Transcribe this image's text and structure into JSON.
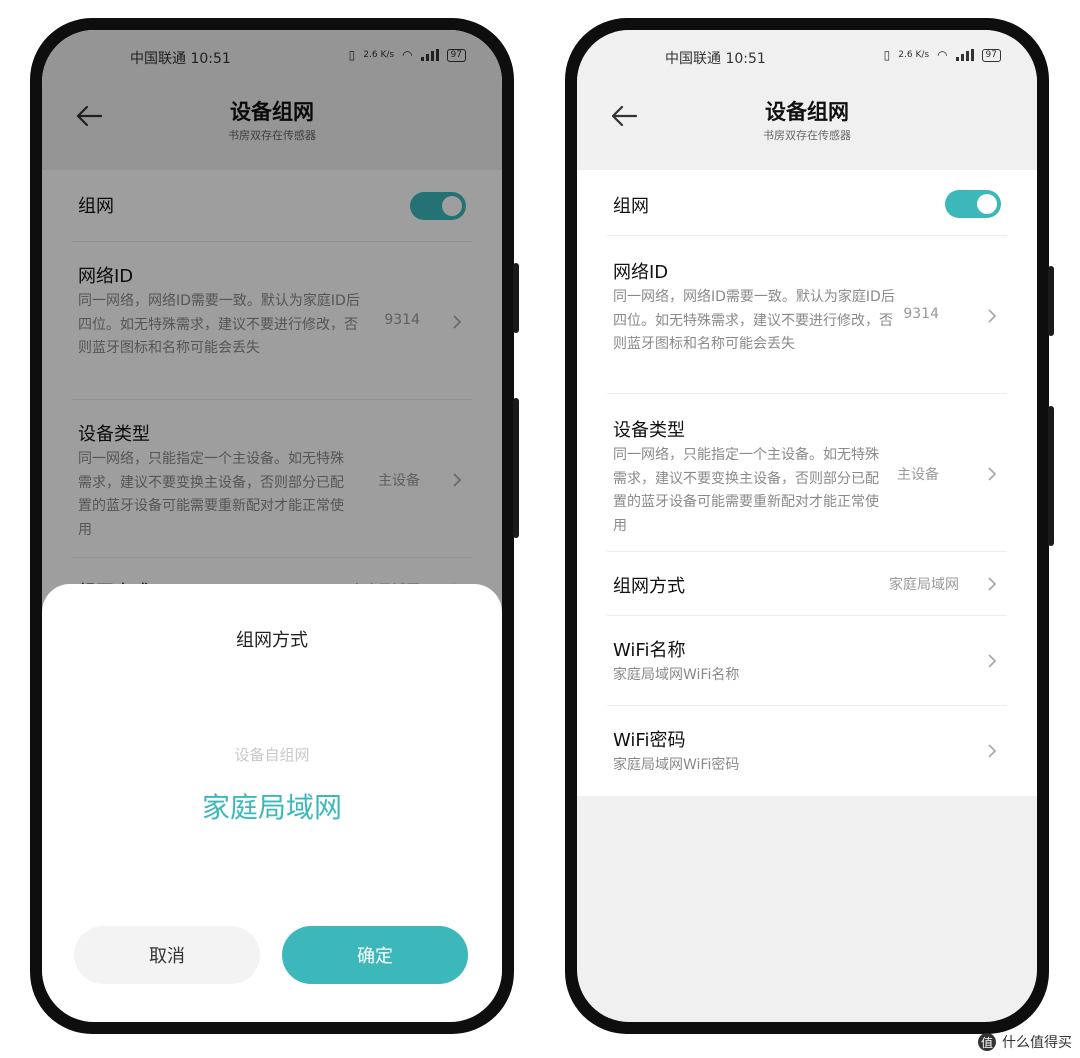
{
  "status_bar": {
    "carrier_time": "中国联通 10:51",
    "network_speed": "2.6 K/s",
    "battery": "97"
  },
  "header": {
    "title": "设备组网",
    "subtitle": "书房双存在传感器"
  },
  "settings": {
    "networking": {
      "label": "组网",
      "enabled": true
    },
    "network_id": {
      "title": "网络ID",
      "desc": "同一网络，网络ID需要一致。默认为家庭ID后四位。如无特殊需求，建议不要进行修改，否则蓝牙图标和名称可能会丢失",
      "value": "9314"
    },
    "device_type": {
      "title": "设备类型",
      "desc": "同一网络，只能指定一个主设备。如无特殊需求，建议不要变换主设备，否则部分已配置的蓝牙设备可能需要重新配对才能正常使用",
      "value": "主设备"
    },
    "network_mode": {
      "title": "组网方式",
      "value": "家庭局域网"
    },
    "wifi_name": {
      "title": "WiFi名称",
      "desc": "家庭局域网WiFi名称"
    },
    "wifi_password": {
      "title": "WiFi密码",
      "desc": "家庭局域网WiFi密码"
    }
  },
  "dialog": {
    "title": "组网方式",
    "options": [
      "设备自组网",
      "家庭局域网"
    ],
    "selected": "家庭局域网",
    "cancel_label": "取消",
    "confirm_label": "确定"
  },
  "watermark": {
    "icon_text": "值",
    "text": "什么值得买"
  },
  "colors": {
    "accent": "#3cb8bb",
    "background": "#f0f0f0"
  }
}
